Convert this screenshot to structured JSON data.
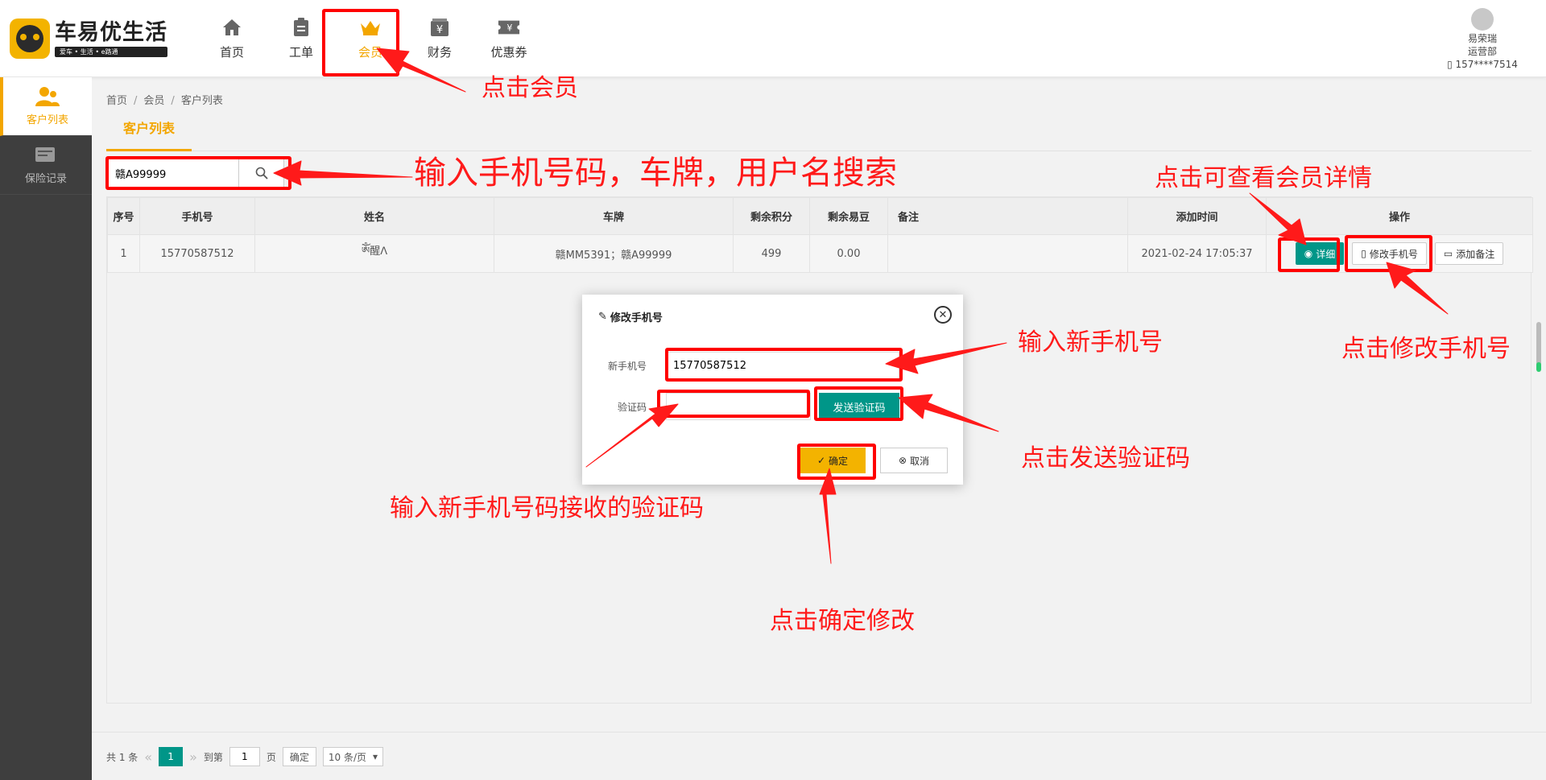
{
  "brand": {
    "title": "车易优生活",
    "subtitle": "爱车 • 生活 • e路通"
  },
  "nav": [
    {
      "label": "首页",
      "icon": "home-icon"
    },
    {
      "label": "工单",
      "icon": "clipboard-icon"
    },
    {
      "label": "会员",
      "icon": "crown-icon"
    },
    {
      "label": "财务",
      "icon": "finance-icon"
    },
    {
      "label": "优惠券",
      "icon": "coupon-icon"
    }
  ],
  "user": {
    "name": "易荣瑞",
    "dept": "运营部",
    "phone": "157****7514"
  },
  "sidebar": [
    {
      "label": "客户列表",
      "icon": "users-icon"
    },
    {
      "label": "保险记录",
      "icon": "insurance-icon"
    }
  ],
  "breadcrumb": {
    "home": "首页",
    "section": "会员",
    "page": "客户列表"
  },
  "tab": {
    "label": "客户列表"
  },
  "search": {
    "value": "赣A99999"
  },
  "table": {
    "headers": [
      "序号",
      "手机号",
      "姓名",
      "车牌",
      "剩余积分",
      "剩余易豆",
      "备注",
      "添加时间",
      "操作"
    ],
    "rows": [
      {
        "index": "1",
        "phone": "15770587512",
        "name": "ༀ醒ᐱ",
        "plate": "赣MM5391；赣A99999",
        "points": "499",
        "beans": "0.00",
        "remark": "",
        "time": "2021-02-24 17:05:37"
      }
    ],
    "actions": {
      "detail": "详细",
      "change_phone": "修改手机号",
      "add_remark": "添加备注"
    }
  },
  "pagination": {
    "total": "共 1 条",
    "current": "1",
    "goto_label": "到第",
    "goto_value": "1",
    "page_suffix": "页",
    "confirm": "确定",
    "page_size": "10 条/页"
  },
  "dialog": {
    "title": "修改手机号",
    "phone_label": "新手机号",
    "phone_value": "15770587512",
    "code_label": "验证码",
    "code_value": "",
    "send_code": "发送验证码",
    "ok": "确定",
    "cancel": "取消"
  },
  "annotations": {
    "click_member": "点击会员",
    "search_hint": "输入手机号码，车牌，用户名搜索",
    "view_detail": "点击可查看会员详情",
    "change_phone": "点击修改手机号",
    "enter_new_phone": "输入新手机号",
    "send_code": "点击发送验证码",
    "enter_code": "输入新手机号码接收的验证码",
    "confirm_change": "点击确定修改"
  },
  "colors": {
    "accent": "#f3a600",
    "teal": "#009688",
    "annotation": "#ff1a1a",
    "sidebar": "#3e3e3e"
  }
}
